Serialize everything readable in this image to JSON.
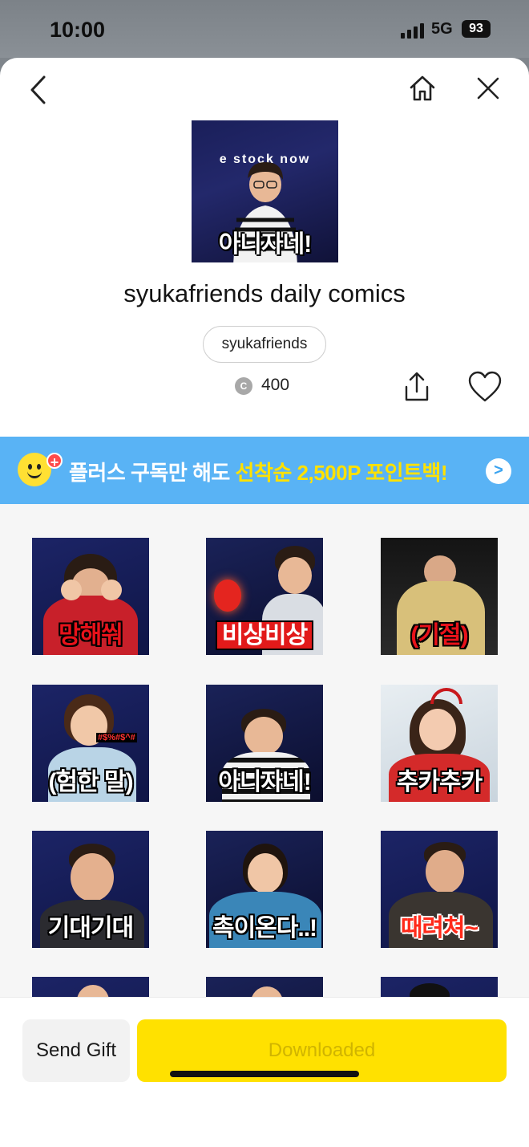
{
  "status_bar": {
    "time": "10:00",
    "network": "5G",
    "battery": "93"
  },
  "nav": {
    "back_icon": "chevron-left-icon",
    "home_icon": "home-icon",
    "close_icon": "close-icon"
  },
  "product": {
    "hero_ticker": "e stock    now",
    "hero_caption": "아니자네!",
    "title": "syukafriends daily comics",
    "artist": "syukafriends",
    "coin_symbol": "C",
    "price": "400"
  },
  "banner": {
    "text_a": "플러스 구독만 해도 ",
    "text_b": "선착순 2,500P 포인트백!",
    "arrow": ">",
    "plus": "+"
  },
  "stickers": [
    {
      "caption": "망해쒀",
      "style": "red"
    },
    {
      "caption": "비상비상",
      "style": "redbox"
    },
    {
      "caption": "(기절)",
      "style": "red"
    },
    {
      "caption": "(험한 말)",
      "style": "white",
      "sub": "#$%#$^#"
    },
    {
      "caption": "아니자네!",
      "style": "white"
    },
    {
      "caption": "추카추카",
      "style": "white"
    },
    {
      "caption": "기대기대",
      "style": "white"
    },
    {
      "caption": "촉이온다..!",
      "style": "white"
    },
    {
      "caption": "때려쳐~",
      "style": "fire"
    }
  ],
  "actions": {
    "gift_label": "Send Gift",
    "download_label": "Downloaded"
  },
  "colors": {
    "accent_yellow": "#ffe100",
    "banner_blue": "#59b3f5",
    "caption_red": "#e8121a"
  }
}
